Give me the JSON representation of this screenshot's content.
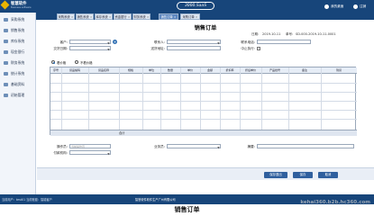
{
  "header": {
    "logo_line1": "智慧软件",
    "logo_line2": "Business software",
    "version": "3000.SaaS",
    "buttons": [
      "我的桌面",
      "注销"
    ]
  },
  "tabs": [
    {
      "label": "采购系统",
      "active": false
    },
    {
      "label": "销售系统",
      "active": false
    },
    {
      "label": "库存系统",
      "active": false
    },
    {
      "label": "资金银行",
      "active": false
    },
    {
      "label": "财务系统",
      "active": false
    },
    {
      "label": "销售订单",
      "active": true
    },
    {
      "label": "采购订单",
      "active": false
    }
  ],
  "sidebar": {
    "items": [
      "采购系统",
      "销售系统",
      "库存系统",
      "现金银行",
      "财务系统",
      "统计系统",
      "基础资料",
      "初始管理"
    ]
  },
  "form": {
    "title": "销售订单",
    "date_label": "日期:",
    "date_value": "2019-10-11",
    "number_label": "单号:",
    "number_value": "SD-000-2019-10-11-0001",
    "customer_label": "客户:",
    "contact_label": "联系人:",
    "phone_label": "联系电话:",
    "delivery_date_label": "交货日期:",
    "address_label": "送货地址:",
    "stop_label": "中止执行:",
    "radio_options": [
      "看价格",
      "不看价格"
    ]
  },
  "table": {
    "columns": [
      "序号",
      "货品编码",
      "货品名称",
      "规格",
      "单位",
      "数量",
      "单价",
      "金额",
      "折扣率",
      "折后单价",
      "产品批号",
      "备注",
      "到货"
    ],
    "total_label": "合计"
  },
  "footer_form": {
    "operator_label": "操作员:",
    "operator_placeholder": "当前操作员",
    "payment_label": "付款机构:",
    "salesman_label": "业务员:",
    "summary_label": "摘要:"
  },
  "actions": [
    "保存退出",
    "保存",
    "取消"
  ],
  "vendor": {
    "name": "华为云",
    "status_left": "当前用户：test01   当前账套：智能客户",
    "status_center": "智慧软件软件生产广州有限公司"
  },
  "caption": "销售订单",
  "watermark": "kehai360.b2b.hc360.com"
}
